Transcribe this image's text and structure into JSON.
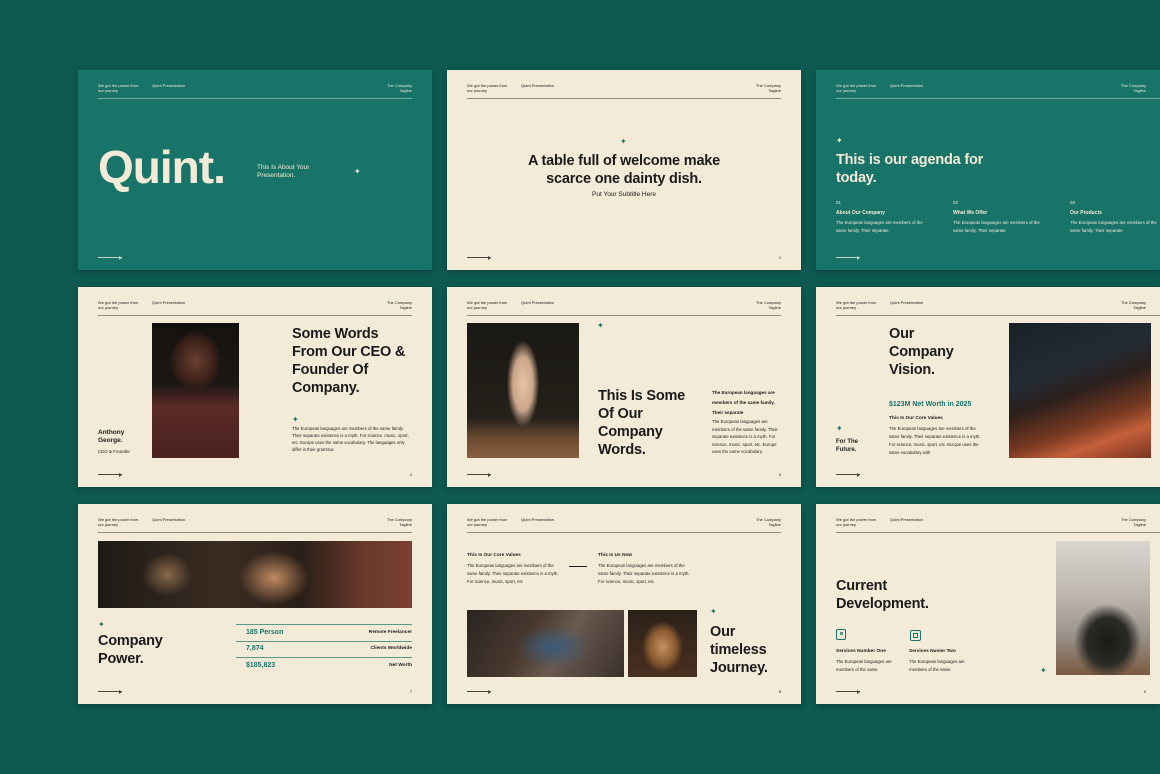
{
  "common": {
    "header_left": "We got the power from our journey",
    "header_mid": "Quint Presentation",
    "header_right": "The Company Tagline"
  },
  "slide1": {
    "title": "Quint.",
    "subtitle": "This Is About Your Presentation."
  },
  "slide2": {
    "title": "A table full of welcome make scarce one dainty dish.",
    "subtitle": "Put Your Subtitle Here",
    "page": "2"
  },
  "slide3": {
    "title": "This is our agenda for today.",
    "items": [
      {
        "num": "01",
        "label": "About Our Company",
        "text": "The European languages are members of the same family. Their separate"
      },
      {
        "num": "02",
        "label": "What We Offer",
        "text": "The European languages are members of the same family. Their separate"
      },
      {
        "num": "03",
        "label": "Our Products",
        "text": "The European languages are members of the same family. Their separate"
      }
    ]
  },
  "slide4": {
    "title": "Some Words From Our CEO & Founder Of Company.",
    "name": "Anthony George.",
    "role": "CEO & Founder",
    "text": "The European languages are members of the same family. Their separate existence is a myth. For science, music, sport, etc. Europe uses the same vocabulary. The languages only differ in their grammar",
    "page": "4"
  },
  "slide5": {
    "title": "This Is Some Of Our Company Words.",
    "lead": "The European languages are members of the same family. Their separate",
    "text": "The European languages are members of the same family. Their separate existence is a myth. For science, music, sport, etc. Europe uses the same vocabulary.",
    "page": "5"
  },
  "slide6": {
    "title": "Our Company Vision.",
    "stat": "$123M Net Worth in 2025",
    "sub": "This Is Our Core Values",
    "text": "The European languages are members of the same family. Their separate existence is a myth. For science, music, sport, etc. Europe uses the same vocabulary with",
    "future": "For The Future."
  },
  "slide7": {
    "title": "Company Power.",
    "rows": [
      {
        "value": "185 Person",
        "label": "Remote Freelancer"
      },
      {
        "value": "7,874",
        "label": "Clients Worldwide"
      },
      {
        "value": "$185,823",
        "label": "Net Worth"
      }
    ],
    "page": "7"
  },
  "slide8": {
    "col1_title": "This Is Our Core Values",
    "col1_text": "The European languages are members of the same family. Their separate existence is a myth. For science, music, sport, etc",
    "col2_title": "This Is Us Now",
    "col2_text": "The European languages are members of the same family. Their separate existence is a myth. For science, music, sport, etc",
    "title": "Our timeless Journey.",
    "page": "8"
  },
  "slide9": {
    "title": "Current Development.",
    "s1_title": "Services Number One",
    "s1_text": "The European languages are members of the same",
    "s2_title": "Services Numer Two",
    "s2_text": "The European languages are members of the same",
    "page": "9"
  },
  "colors": {
    "background": "#0e5a50",
    "teal": "#187468",
    "cream": "#f3ead8",
    "ink": "#1b1b1b"
  }
}
